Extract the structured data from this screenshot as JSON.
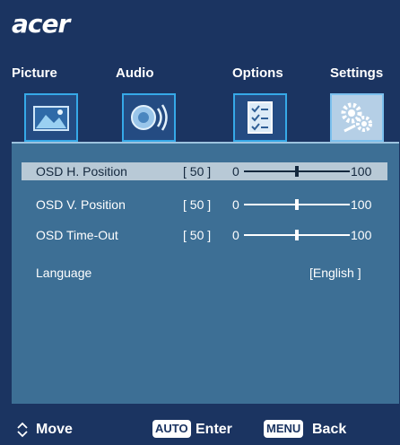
{
  "brand": {
    "logo_text": "acer"
  },
  "tabs": [
    {
      "label": "Picture",
      "icon": "picture-icon"
    },
    {
      "label": "Audio",
      "icon": "speaker-icon"
    },
    {
      "label": "Options",
      "icon": "checklist-icon"
    },
    {
      "label": "Settings",
      "icon": "gears-icon",
      "active": true
    }
  ],
  "settings": [
    {
      "label": "OSD H. Position",
      "value": "[ 50 ]",
      "min": "0",
      "max": "100",
      "level": 50,
      "selected": true
    },
    {
      "label": "OSD V. Position",
      "value": "[ 50 ]",
      "min": "0",
      "max": "100",
      "level": 50
    },
    {
      "label": "OSD Time-Out",
      "value": "[ 50 ]",
      "min": "0",
      "max": "100",
      "level": 50
    }
  ],
  "language": {
    "label": "Language",
    "value": "[English ]"
  },
  "footer": {
    "move": "Move",
    "auto_key": "AUTO",
    "enter": "Enter",
    "menu_key": "MENU",
    "back": "Back"
  },
  "colors": {
    "background": "#1b3461",
    "panel": "#3d6f95",
    "selection": "#b8c9d6",
    "tab_border": "#36a9e8"
  }
}
